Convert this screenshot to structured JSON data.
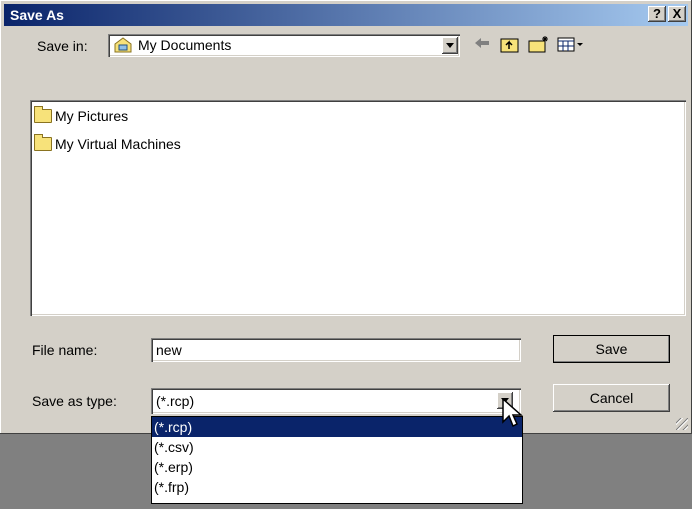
{
  "window": {
    "title": "Save As",
    "help_label": "?",
    "close_label": "X"
  },
  "save_in": {
    "label": "Save in:",
    "value": "My Documents"
  },
  "toolbar": {
    "back_icon": "back-arrow-icon",
    "up_icon": "up-folder-icon",
    "new_folder_icon": "new-folder-icon",
    "views_icon": "views-menu-icon"
  },
  "files": [
    {
      "name": "My Pictures",
      "icon": "pictures-folder-icon"
    },
    {
      "name": "My Virtual Machines",
      "icon": "folder-icon"
    }
  ],
  "filename": {
    "label": "File name:",
    "value": "new"
  },
  "save_type": {
    "label": "Save as type:",
    "value": "(*.rcp)",
    "options": [
      "(*.rcp)",
      "(*.csv)",
      "(*.erp)",
      "(*.frp)"
    ],
    "selected_index": 0
  },
  "buttons": {
    "save": "Save",
    "cancel": "Cancel"
  },
  "colors": {
    "title_start": "#0a246a",
    "title_end": "#a6caf0",
    "selection": "#0a246a",
    "face": "#d4d0c8"
  }
}
